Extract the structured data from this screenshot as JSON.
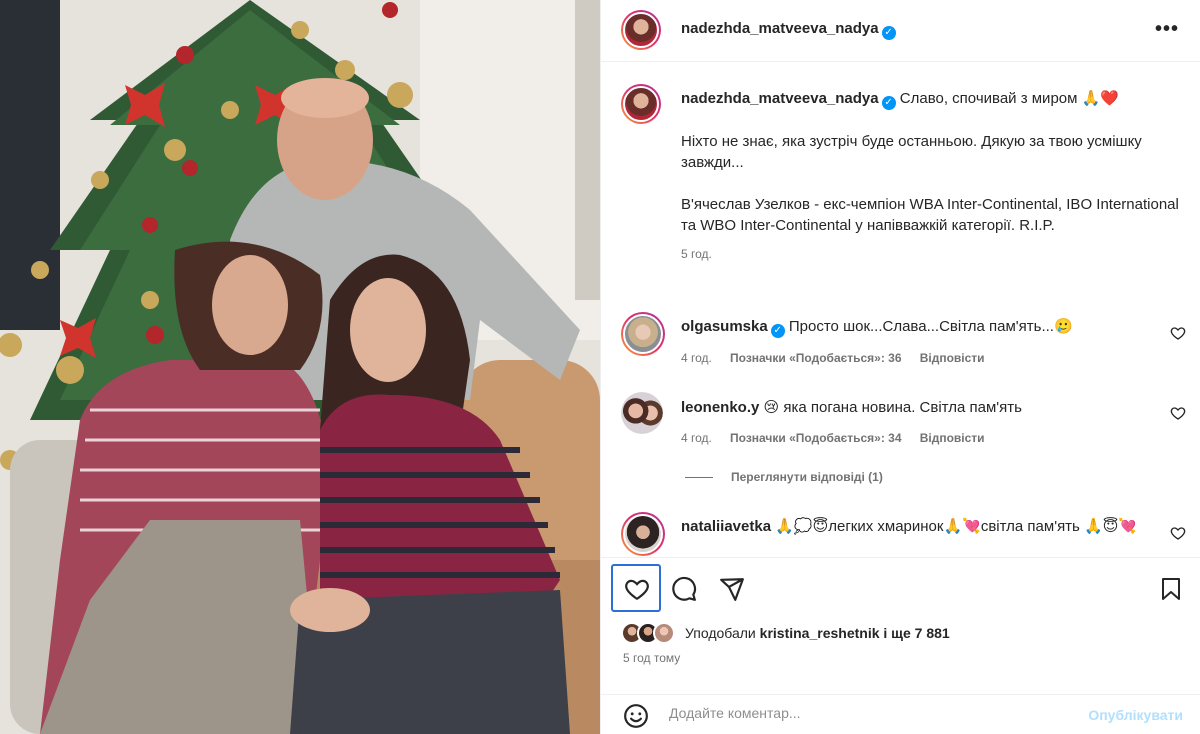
{
  "post": {
    "author": "nadezhda_matveeva_nadya",
    "caption_first": "Славо, спочивай з миром 🙏❤️",
    "caption_p2": "Ніхто не знає, яка зустріч буде останньою. Дякую за твою усмішку завжди...",
    "caption_p3": "В'ячеслав Узелков - екс-чемпіон WBA Inter-Continental, IBO International та WBO Inter-Continental у напівважкій категорії. R.I.P.",
    "caption_time": "5 год."
  },
  "comments": [
    {
      "user": "olgasumska",
      "verified": true,
      "text": "Просто шок...Слава...Світла пам'ять...🥲",
      "time": "4 год.",
      "likes": "Позначки «Подобається»: 36",
      "reply": "Відповісти"
    },
    {
      "user": "leonenko.y",
      "verified": false,
      "text": "😢 яка погана новина. Світла пам'ять",
      "time": "4 год.",
      "likes": "Позначки «Подобається»: 34",
      "reply": "Відповісти"
    },
    {
      "user": "nataliiavetka",
      "verified": false,
      "text": "🙏💭😇легких хмаринок🙏💘світла пам'ять 🙏😇💘"
    }
  ],
  "view_replies": "Переглянути відповіді (1)",
  "liked_by": {
    "prefix": "Уподобали ",
    "user": "kristina_reshetnik",
    "suffix": " і ще 7 881"
  },
  "post_time": "5 год тому",
  "add_comment": {
    "placeholder": "Додайте коментар...",
    "post_label": "Опублікувати"
  },
  "colors": {
    "accent": "#0095f6",
    "focus_ring": "#2c6fd6",
    "muted": "#737373"
  }
}
